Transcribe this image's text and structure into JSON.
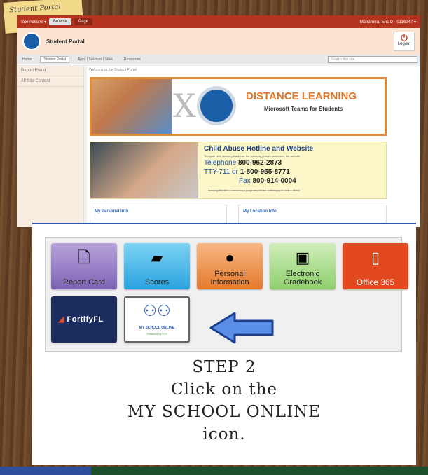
{
  "sticky_note": {
    "text": "Student Portal"
  },
  "topbar": {
    "site_actions": "Site Actions ▾",
    "tab_browse": "Browse",
    "tab_page": "Page",
    "user": "Mañarrera, Eric D - 0116247 ▾"
  },
  "header": {
    "title": "Student Portal",
    "logout_label": "Logout"
  },
  "nav": {
    "items": [
      "Home",
      "Student Portal",
      "Apps | Services | Sites",
      "Resources"
    ],
    "search_placeholder": "Search this site..."
  },
  "left_pane": {
    "items": [
      "Report Fraud",
      "All Site Content"
    ]
  },
  "main": {
    "welcome": "Welcome to the Student Portal",
    "distance_learning": {
      "title": "DISTANCE LEARNING",
      "subtitle": "Microsoft Teams for Students"
    },
    "hotline": {
      "title": "Child Abuse Hotline and Website",
      "intro": "To report child abuse, please use the following phone numbers or the website",
      "telephone_label": "Telephone",
      "telephone": "800-962-2873",
      "tty_label": "TTY-711 or",
      "tty": "1-800-955-8771",
      "fax_label": "Fax",
      "fax": "800-914-0004",
      "url": "www.myflfamilies.com/service-programs/abuse-hotline/report-online.shtml"
    },
    "sections": [
      "My Personal Info",
      "My Location Info"
    ]
  },
  "tiles": {
    "report_card": "Report Card",
    "scores": "Scores",
    "personal_info": "Personal Information",
    "gradebook": "Electronic Gradebook",
    "office365": "Office 365",
    "fortify": "FortifyFL",
    "mso_title": "MY SCHOOL ONLINE",
    "mso_sub": "Powered by K12"
  },
  "instruction": {
    "line1": "STEP 2",
    "line2": "Click on the",
    "line3": "MY SCHOOL ONLINE",
    "line4": "icon."
  },
  "colors": {
    "topbar": "#b5341f",
    "accent_orange": "#e58a2c",
    "arrow_blue": "#2f6bd0"
  }
}
